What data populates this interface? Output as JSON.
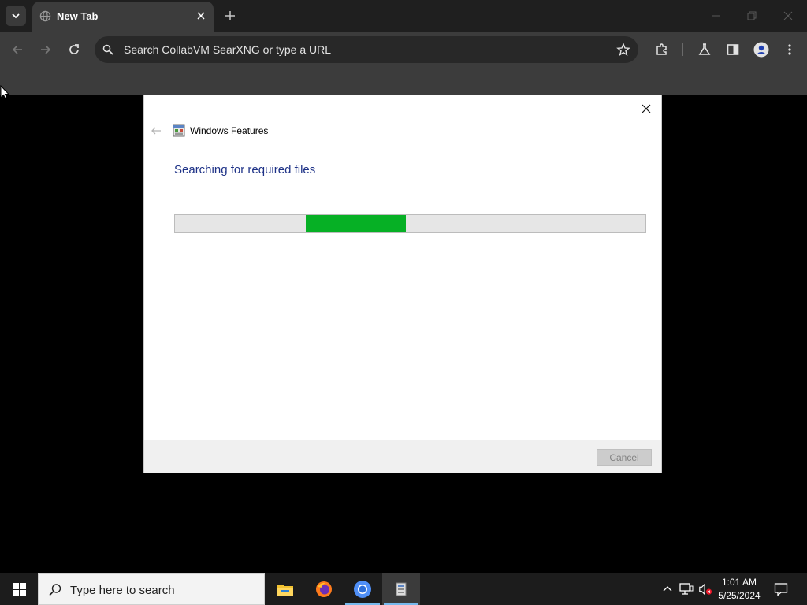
{
  "browser": {
    "tab": {
      "title": "New Tab"
    },
    "omnibox": {
      "placeholder": "Search CollabVM SearXNG or type a URL"
    }
  },
  "dialog": {
    "title": "Windows Features",
    "heading": "Searching for required files",
    "progress": {
      "fill_start_fraction": 0.278,
      "fill_width_fraction": 0.212,
      "fill_color": "#06b025"
    },
    "cancel_label": "Cancel"
  },
  "taskbar": {
    "search_placeholder": "Type here to search",
    "apps": [
      {
        "name": "file-explorer"
      },
      {
        "name": "firefox"
      },
      {
        "name": "chromium"
      },
      {
        "name": "windows-features",
        "active": true
      }
    ],
    "clock": {
      "time": "1:01 AM",
      "date": "5/25/2024"
    }
  },
  "colors": {
    "accent_heading": "#1e3287",
    "taskbar_bg": "#1c1c1c",
    "chrome_toolbar": "#3c3c3c"
  }
}
